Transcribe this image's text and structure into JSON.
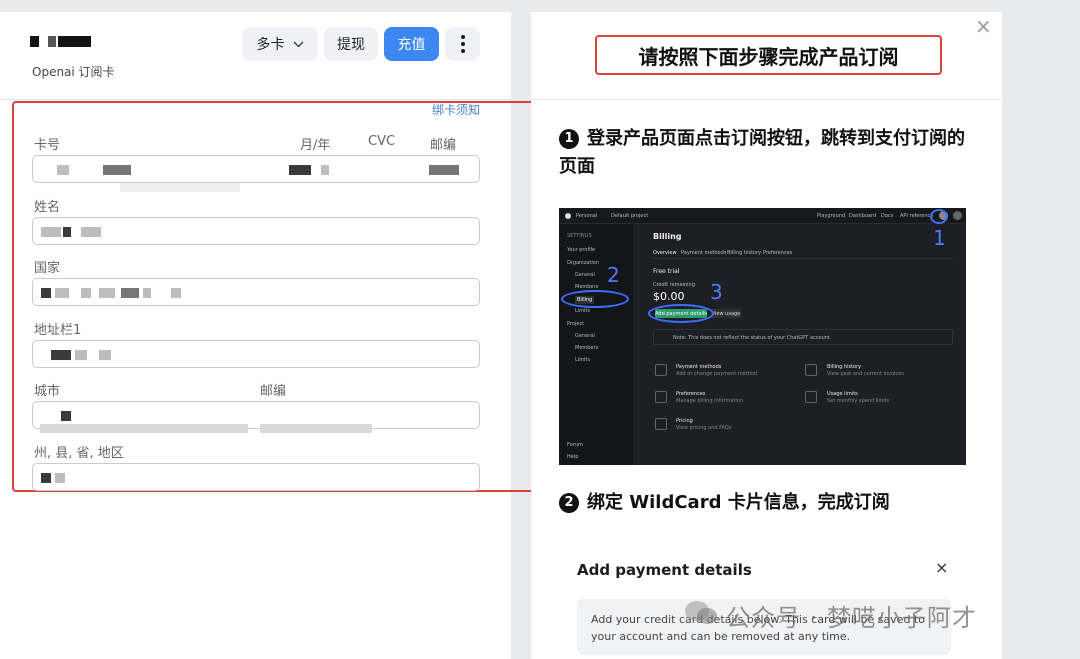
{
  "left": {
    "subtitle": "Openai 订阅卡",
    "buttons": {
      "card": "多卡",
      "withdraw": "提现",
      "topup": "充值"
    },
    "bind_note": "绑卡须知",
    "labels": {
      "card_number": "卡号",
      "expiry": "月/年",
      "cvc": "CVC",
      "postal": "邮编",
      "name": "姓名",
      "country": "国家",
      "address": "地址栏1",
      "city": "城市",
      "city_postal": "邮编",
      "state": "州, 县, 省, 地区"
    }
  },
  "right": {
    "title": "请按照下面步骤完成产品订阅",
    "step1": {
      "num": "1",
      "text": "登录产品页面点击订阅按钮，跳转到支付订阅的页面"
    },
    "step2": {
      "num": "2",
      "text": "绑定 WildCard 卡片信息，完成订阅"
    },
    "billing": {
      "top": {
        "org": "Personal",
        "project": "Default project",
        "nav": [
          "Playground",
          "Dashboard",
          "Docs",
          "API reference"
        ]
      },
      "sidebar": {
        "heading": "SETTINGS",
        "items": [
          "Your profile",
          "Organization",
          "General",
          "Members",
          "Billing",
          "Limits",
          "Project",
          "General",
          "Members",
          "Limits"
        ],
        "footer": [
          "Forum",
          "Help"
        ]
      },
      "title": "Billing",
      "tabs": [
        "Overview",
        "Payment methods",
        "Billing history",
        "Preferences"
      ],
      "plan": "Free trial",
      "credit_label": "Credit remaining",
      "credit": "$0.00",
      "add_button": "Add payment details",
      "usage_button": "View usage",
      "note": "Note: This does not reflect the status of your ChatGPT account.",
      "cards": [
        {
          "title": "Payment methods",
          "desc": "Add or change payment method"
        },
        {
          "title": "Billing history",
          "desc": "View past and current invoices"
        },
        {
          "title": "Preferences",
          "desc": "Manage billing information"
        },
        {
          "title": "Usage limits",
          "desc": "Set monthly spend limits"
        },
        {
          "title": "Pricing",
          "desc": "View pricing and FAQs"
        }
      ],
      "annotations": [
        "1",
        "2",
        "3"
      ]
    },
    "payment": {
      "title": "Add payment details",
      "close": "×",
      "text": "Add your credit card details below. This card will be saved to your account and can be removed at any time."
    },
    "watermark": "公众号 · 梦呓小子阿才"
  },
  "close_icon": "×",
  "colors": {
    "accent": "#3d87f2",
    "highlight": "#d9433a",
    "annotation": "#4f7cff"
  }
}
